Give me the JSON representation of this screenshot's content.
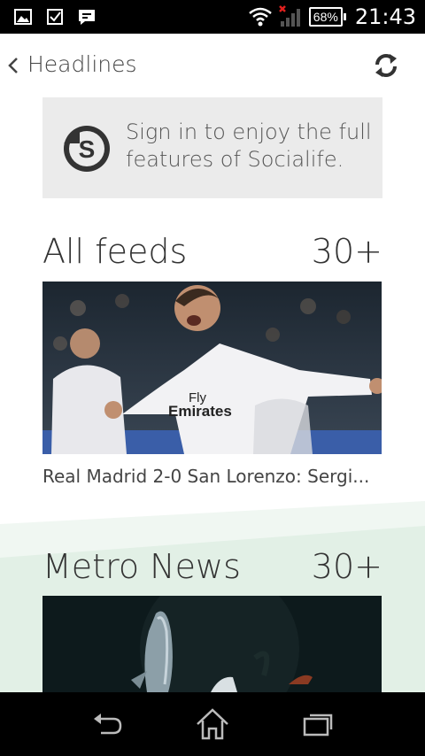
{
  "status_bar": {
    "battery": "68%",
    "time": "21:43",
    "left_icons": [
      "gallery-icon",
      "checkbox-icon",
      "message-icon"
    ],
    "right_icons": [
      "wifi-icon",
      "no-signal-icon",
      "battery-icon"
    ]
  },
  "action_bar": {
    "title": "Headlines",
    "back_icon": "chevron-left-icon",
    "refresh_icon": "refresh-icon"
  },
  "signin_card": {
    "text": "Sign in to enjoy the full features of Socialife.",
    "logo": "socialife-logo"
  },
  "sections": [
    {
      "title": "All feeds",
      "count": "30+",
      "headline": "Real Madrid 2-0 San Lorenzo: Sergi...",
      "image": "football-player-photo"
    },
    {
      "title": "Metro News",
      "count": "30+",
      "image": "deep-sea-fish-photo"
    }
  ],
  "nav_bar": {
    "buttons": [
      "back-icon",
      "home-icon",
      "recent-apps-icon"
    ]
  },
  "colors": {
    "accent_green": "#e2f0e6",
    "card_gray": "#ebebeb",
    "notification_red": "#e0201e"
  }
}
